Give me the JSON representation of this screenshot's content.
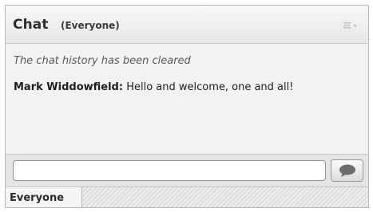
{
  "header": {
    "title": "Chat",
    "subtitle": "(Everyone)",
    "menu_icon": "panel-menu-icon"
  },
  "history": {
    "system_notice": "The chat history has been cleared",
    "messages": [
      {
        "sender": "Mark Widdowfield:",
        "text": " Hello and welcome, one and all!"
      }
    ]
  },
  "composer": {
    "value": "",
    "placeholder": "",
    "send_icon": "speech-bubble-icon"
  },
  "tabs": [
    {
      "label": "Everyone",
      "selected": true
    }
  ]
}
